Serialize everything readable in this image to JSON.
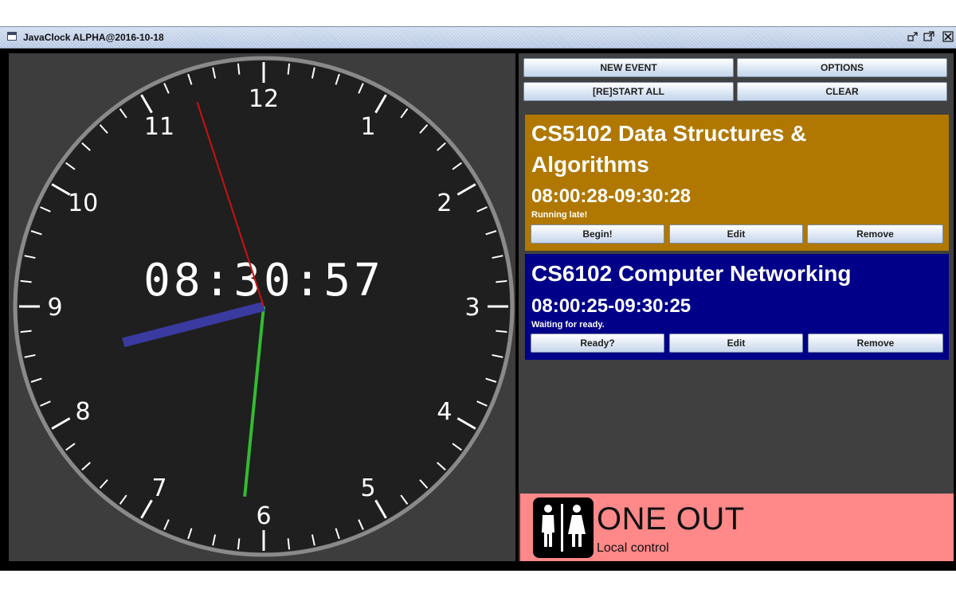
{
  "window": {
    "title": "JavaClock ALPHA@2016-10-18",
    "controls": [
      "restore-icon",
      "maximize-icon",
      "close-icon"
    ]
  },
  "clock": {
    "digital_time": "08:30:57",
    "hour_numbers": [
      "12",
      "1",
      "2",
      "3",
      "4",
      "5",
      "6",
      "7",
      "8",
      "9",
      "10",
      "11"
    ],
    "hands": {
      "hour": {
        "value": 8.52,
        "color": "#3a3aa0"
      },
      "minute": {
        "value": 30.95,
        "color": "#33bb33"
      },
      "second": {
        "value": 57,
        "color": "#cc1111"
      }
    },
    "face_color": "#1f1f1f",
    "rim_color": "#8a8a8a"
  },
  "toolbar": {
    "new_event": "NEW EVENT",
    "options": "OPTIONS",
    "restart_all": "[RE]START ALL",
    "clear": "CLEAR"
  },
  "events": [
    {
      "title": "CS5102 Data Structures & Algorithms",
      "title_line1": "CS5102 Data Structures &",
      "title_line2": "Algorithms",
      "time": "08:00:28-09:30:28",
      "status": "Running late!",
      "color": "#b07800",
      "buttons": [
        "Begin!",
        "Edit",
        "Remove"
      ]
    },
    {
      "title": "CS6102 Computer Networking",
      "time": "08:00:25-09:30:25",
      "status": "Waiting for ready.",
      "color": "#000088",
      "buttons": [
        "Ready?",
        "Edit",
        "Remove"
      ]
    }
  ],
  "restroom_status": {
    "main": "ONE OUT",
    "sub": "Local control",
    "icon": "restroom-icon",
    "color": "#ff8888"
  }
}
